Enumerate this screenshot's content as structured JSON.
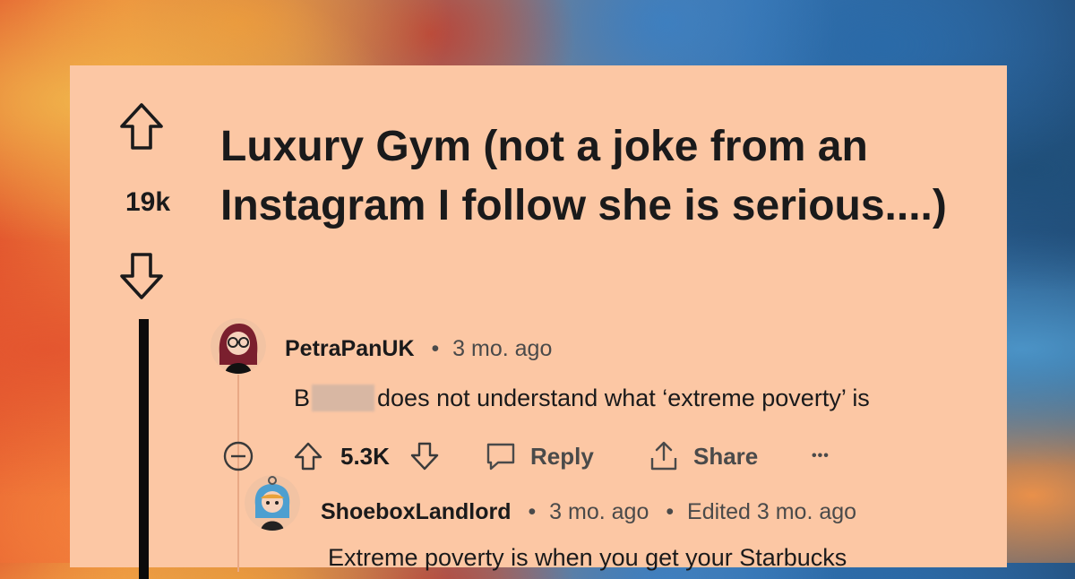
{
  "post": {
    "votes": "19k",
    "title": "Luxury Gym (not a joke from an Instagram I follow she is serious....)"
  },
  "comments": [
    {
      "username": "PetraPanUK",
      "separator": "•",
      "age": "3 mo. ago",
      "text_prefix": "B",
      "text_rest": "does not understand what ‘extreme poverty’ is",
      "score": "5.3K",
      "reply_label": "Reply",
      "share_label": "Share",
      "more_label": "•••"
    },
    {
      "username": "ShoeboxLandlord",
      "separator": "•",
      "age": "3 mo. ago",
      "separator2": "•",
      "edited": "Edited 3 mo. ago",
      "text": "Extreme poverty is when you get your Starbucks"
    }
  ],
  "icons": [
    "upvote-icon",
    "downvote-icon",
    "collapse-icon",
    "reply-icon",
    "share-icon",
    "more-icon"
  ]
}
